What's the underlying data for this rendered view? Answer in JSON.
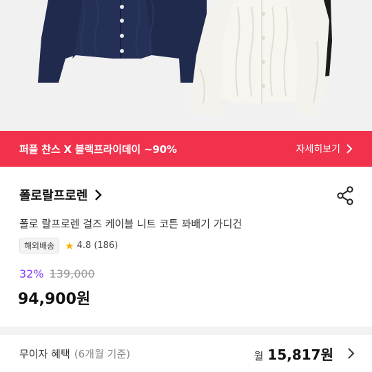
{
  "promo": {
    "title": "퍼플 찬스 X 블랙프라이데이 ~90%",
    "link_label": "자세히보기",
    "link_icon": "chevron-right-icon",
    "background": "#f0324c"
  },
  "product": {
    "brand": "폴로랄프로렌",
    "name": "폴로 랄프로렌 걸즈 케이블 니트 코튼 꽈배기 가디건",
    "shipping_badge": "해외배송",
    "rating": "4.8",
    "review_count": "(186)",
    "discount_rate": "32%",
    "original_price": "139,000",
    "final_price": "94,900원"
  },
  "installment": {
    "label": "무이자 혜택",
    "sub": "(6개월 기준)",
    "prefix": "월",
    "amount": "15,817원"
  },
  "colors": {
    "accent_purple": "#8a3ffc",
    "star": "#f5b300",
    "navy_item": "#1f2a4d",
    "cream_item": "#f4f2ec"
  }
}
